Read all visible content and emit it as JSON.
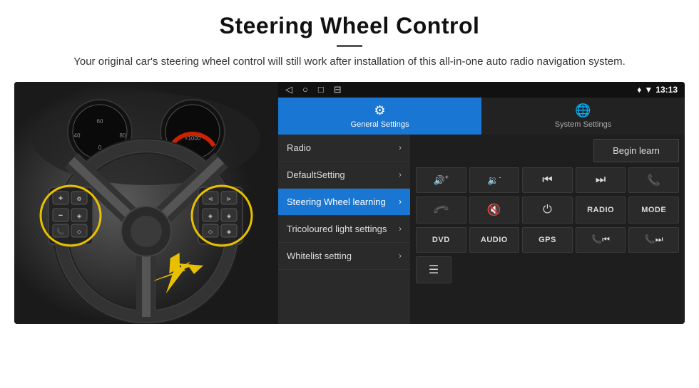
{
  "header": {
    "title": "Steering Wheel Control",
    "description": "Your original car's steering wheel control will still work after installation of this all-in-one auto radio navigation system."
  },
  "statusBar": {
    "backIcon": "◁",
    "homeIcon": "○",
    "recentIcon": "□",
    "screencastIcon": "⊟",
    "locationIcon": "♦",
    "wifiIcon": "▼",
    "time": "13:13"
  },
  "tabs": [
    {
      "id": "general",
      "label": "General Settings",
      "icon": "⚙",
      "active": true
    },
    {
      "id": "system",
      "label": "System Settings",
      "icon": "🌐",
      "active": false
    }
  ],
  "menuItems": [
    {
      "id": "radio",
      "label": "Radio",
      "active": false
    },
    {
      "id": "defaultsetting",
      "label": "DefaultSetting",
      "active": false
    },
    {
      "id": "steeringwheel",
      "label": "Steering Wheel learning",
      "active": true
    },
    {
      "id": "tricoloured",
      "label": "Tricoloured light settings",
      "active": false
    },
    {
      "id": "whitelist",
      "label": "Whitelist setting",
      "active": false
    }
  ],
  "beginLearnLabel": "Begin learn",
  "controlButtons": {
    "row1": [
      {
        "id": "vol-up",
        "icon": "🔊+",
        "label": "vol-up"
      },
      {
        "id": "vol-down",
        "icon": "🔉-",
        "label": "vol-down"
      },
      {
        "id": "prev-track",
        "icon": "⏮",
        "label": "prev-track"
      },
      {
        "id": "next-track",
        "icon": "⏭",
        "label": "next-track"
      },
      {
        "id": "phone",
        "icon": "📞",
        "label": "phone"
      }
    ],
    "row2": [
      {
        "id": "phone-answer",
        "icon": "↩",
        "label": "phone-answer"
      },
      {
        "id": "mute",
        "icon": "🔇",
        "label": "mute"
      },
      {
        "id": "power",
        "icon": "⏻",
        "label": "power"
      },
      {
        "id": "radio-btn",
        "text": "RADIO",
        "label": "radio-btn"
      },
      {
        "id": "mode-btn",
        "text": "MODE",
        "label": "mode-btn"
      }
    ],
    "row3": [
      {
        "id": "dvd-btn",
        "text": "DVD",
        "label": "dvd-btn"
      },
      {
        "id": "audio-btn",
        "text": "AUDIO",
        "label": "audio-btn"
      },
      {
        "id": "gps-btn",
        "text": "GPS",
        "label": "gps-btn"
      },
      {
        "id": "tel-prev",
        "icon": "📞⏮",
        "label": "tel-prev"
      },
      {
        "id": "tel-next",
        "icon": "📞⏭",
        "label": "tel-next"
      }
    ],
    "extraRow": [
      {
        "id": "menu-icon",
        "icon": "≡",
        "label": "menu"
      }
    ]
  }
}
